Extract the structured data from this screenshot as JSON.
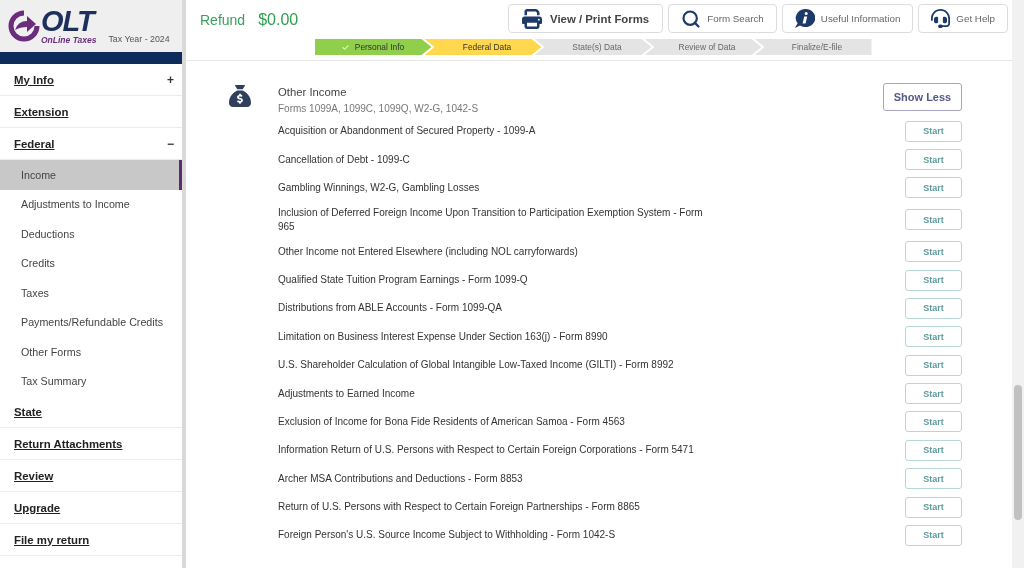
{
  "logo": {
    "wordmark": "OLT",
    "tagline": "OnLine Taxes",
    "tax_year": "Tax Year - 2024"
  },
  "sidebar": {
    "items": [
      {
        "label": "My Info",
        "toggle": "+"
      },
      {
        "label": "Extension"
      },
      {
        "label": "Federal",
        "toggle": "−",
        "children": [
          {
            "label": "Income",
            "selected": true
          },
          {
            "label": "Adjustments to Income",
            "selected": false
          },
          {
            "label": "Deductions",
            "selected": false
          },
          {
            "label": "Credits",
            "selected": false
          },
          {
            "label": "Taxes",
            "selected": false
          },
          {
            "label": "Payments/Refundable Credits",
            "selected": false
          },
          {
            "label": "Other Forms",
            "selected": false
          },
          {
            "label": "Tax Summary",
            "selected": false
          }
        ]
      },
      {
        "label": "State"
      },
      {
        "label": "Return Attachments"
      },
      {
        "label": "Review"
      },
      {
        "label": "Upgrade"
      },
      {
        "label": "File my return"
      }
    ]
  },
  "refund": {
    "label": "Refund",
    "amount": "$0.00"
  },
  "toolbar": [
    {
      "kind": "print",
      "label": "View / Print Forms"
    },
    {
      "kind": "search",
      "label": "Form Search"
    },
    {
      "kind": "info",
      "label": "Useful Information"
    },
    {
      "kind": "help",
      "label": "Get Help"
    }
  ],
  "steps": [
    {
      "label": "Personal Info",
      "completed": true,
      "selected": false
    },
    {
      "label": "Federal Data",
      "completed": false,
      "selected": true
    },
    {
      "label": "State(s) Data",
      "completed": false,
      "selected": false
    },
    {
      "label": "Review of Data",
      "completed": false,
      "selected": false
    },
    {
      "label": "Finalize/E-file",
      "completed": false,
      "selected": false
    }
  ],
  "section": {
    "title": "Other Income",
    "subtitle": "Forms 1099A, 1099C, 1099Q, W2-G, 1042-S",
    "toggle_button": "Show Less",
    "rows": [
      {
        "label": "Acquisition or Abandonment of Secured Property - 1099-A",
        "action": "Start"
      },
      {
        "label": "Cancellation of Debt - 1099-C",
        "action": "Start"
      },
      {
        "label": "Gambling Winnings, W2-G, Gambling Losses",
        "action": "Start"
      },
      {
        "label": "Inclusion of Deferred Foreign Income Upon Transition to Participation Exemption System - Form 965",
        "action": "Start"
      },
      {
        "label": "Other Income not Entered Elsewhere (including NOL carryforwards)",
        "action": "Start"
      },
      {
        "label": "Qualified State Tuition Program Earnings - Form 1099-Q",
        "action": "Start"
      },
      {
        "label": "Distributions from ABLE Accounts - Form 1099-QA",
        "action": "Start"
      },
      {
        "label": "Limitation on Business Interest Expense Under Section 163(j) - Form 8990",
        "action": "Start"
      },
      {
        "label": "U.S. Shareholder Calculation of Global Intangible Low-Taxed Income (GILTI) - Form 8992",
        "action": "Start"
      },
      {
        "label": "Adjustments to Earned Income",
        "action": "Start"
      },
      {
        "label": "Exclusion of Income for Bona Fide Residents of American Samoa - Form 4563",
        "action": "Start"
      },
      {
        "label": "Information Return of U.S. Persons with Respect to Certain Foreign Corporations - Form 5471",
        "action": "Start"
      },
      {
        "label": "Archer MSA Contributions and Deductions - Form 8853",
        "action": "Start"
      },
      {
        "label": "Return of U.S. Persons with Respect to Certain Foreign Partnerships - Form 8865",
        "action": "Start"
      },
      {
        "label": "Foreign Person's U.S. Source Income Subject to Withholding - Form 1042-S",
        "action": "Start"
      }
    ]
  }
}
